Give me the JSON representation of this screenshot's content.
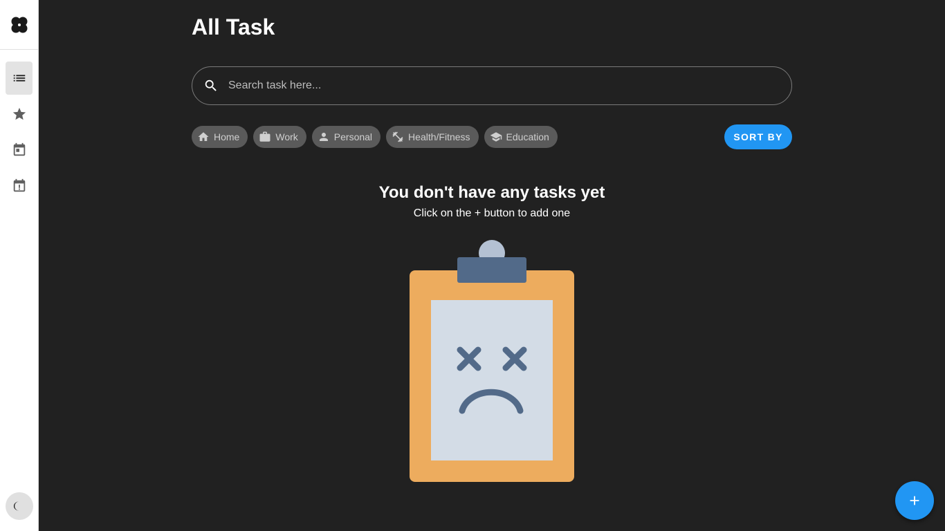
{
  "header": {
    "title": "All Task"
  },
  "search": {
    "placeholder": "Search task here...",
    "value": ""
  },
  "categories": [
    {
      "label": "Home",
      "icon": "home-icon"
    },
    {
      "label": "Work",
      "icon": "briefcase-icon"
    },
    {
      "label": "Personal",
      "icon": "person-icon"
    },
    {
      "label": "Health/Fitness",
      "icon": "fitness-icon"
    },
    {
      "label": "Education",
      "icon": "school-icon"
    }
  ],
  "sort": {
    "label": "SORT BY"
  },
  "empty_state": {
    "title": "You don't have any tasks yet",
    "subtitle": "Click on the + button to add one"
  },
  "sidebar": {
    "items": [
      {
        "name": "all-tasks",
        "icon": "list-icon",
        "active": true
      },
      {
        "name": "important",
        "icon": "star-icon",
        "active": false
      },
      {
        "name": "today",
        "icon": "calendar-icon",
        "active": false
      },
      {
        "name": "overdue",
        "icon": "calendar-alert-icon",
        "active": false
      }
    ]
  },
  "colors": {
    "accent": "#2196f3",
    "background": "#212121",
    "chip": "#5a5a5a",
    "clipboard": "#edac5e",
    "paper": "#d3dce6",
    "face": "#526a89"
  }
}
